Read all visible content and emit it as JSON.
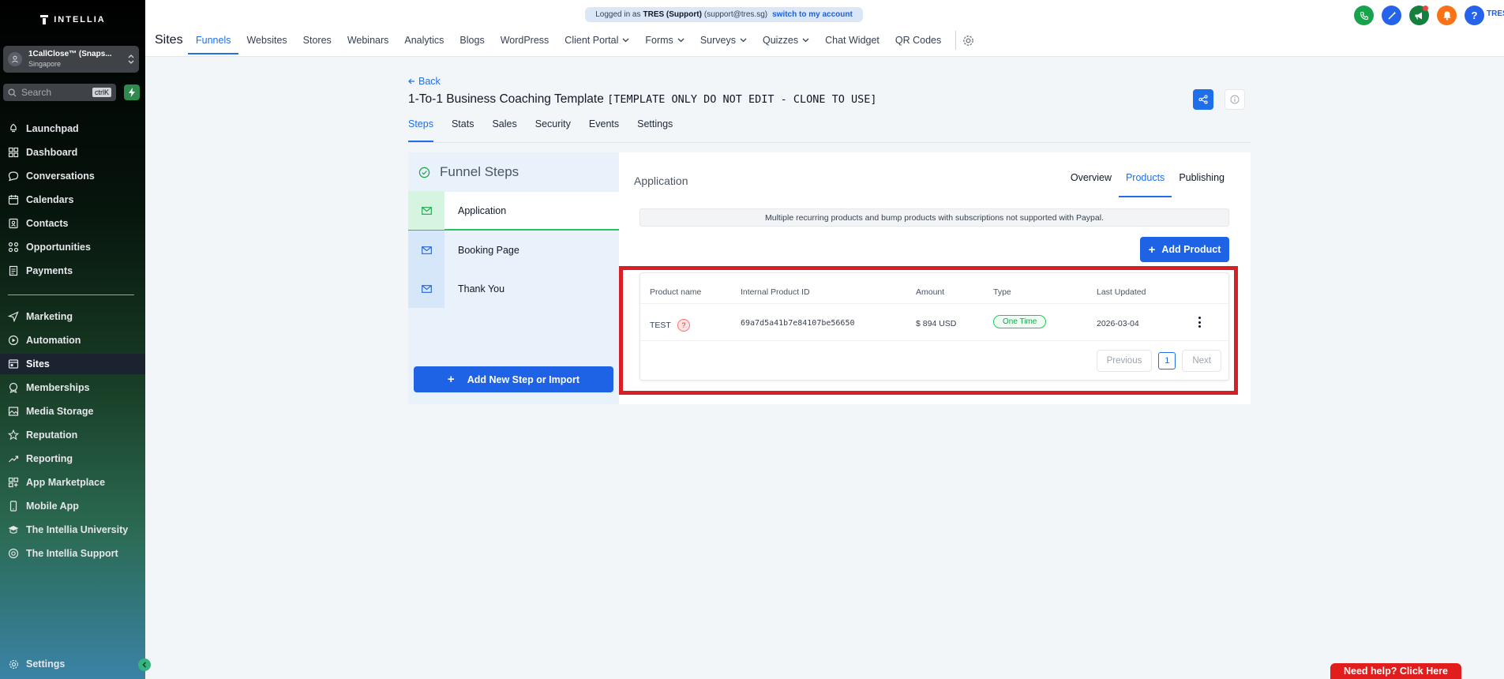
{
  "sidebar": {
    "logo_text": "INTELLIA",
    "account": {
      "name": "1CallClose™ (Snaps...",
      "location": "Singapore"
    },
    "search": {
      "placeholder": "Search",
      "shortcut": "ctrlK"
    },
    "items_top": [
      {
        "label": "Launchpad",
        "icon": "rocket-icon"
      },
      {
        "label": "Dashboard",
        "icon": "grid-icon"
      },
      {
        "label": "Conversations",
        "icon": "chat-icon"
      },
      {
        "label": "Calendars",
        "icon": "calendar-icon"
      },
      {
        "label": "Contacts",
        "icon": "contacts-icon"
      },
      {
        "label": "Opportunities",
        "icon": "opportunities-icon"
      },
      {
        "label": "Payments",
        "icon": "payments-icon"
      }
    ],
    "items_bottom": [
      {
        "label": "Marketing",
        "icon": "send-icon"
      },
      {
        "label": "Automation",
        "icon": "automation-icon"
      },
      {
        "label": "Sites",
        "icon": "sites-icon",
        "active": true
      },
      {
        "label": "Memberships",
        "icon": "membership-icon"
      },
      {
        "label": "Media Storage",
        "icon": "image-icon"
      },
      {
        "label": "Reputation",
        "icon": "star-icon"
      },
      {
        "label": "Reporting",
        "icon": "trend-icon"
      },
      {
        "label": "App Marketplace",
        "icon": "apps-icon"
      },
      {
        "label": "Mobile App",
        "icon": "mobile-icon"
      },
      {
        "label": "The Intellia University",
        "icon": "graduation-icon"
      },
      {
        "label": "The Intellia Support",
        "icon": "support-icon"
      }
    ],
    "settings_label": "Settings"
  },
  "topbar": {
    "login_prefix": "Logged in as",
    "login_user": "TRES (Support)",
    "login_email": "(support@tres.sg)",
    "switch_link": "switch to my account",
    "section_title": "Sites",
    "nav": [
      {
        "label": "Funnels",
        "active": true
      },
      {
        "label": "Websites"
      },
      {
        "label": "Stores"
      },
      {
        "label": "Webinars"
      },
      {
        "label": "Analytics"
      },
      {
        "label": "Blogs"
      },
      {
        "label": "WordPress"
      },
      {
        "label": "Client Portal",
        "dropdown": true
      },
      {
        "label": "Forms",
        "dropdown": true
      },
      {
        "label": "Surveys",
        "dropdown": true
      },
      {
        "label": "Quizzes",
        "dropdown": true
      },
      {
        "label": "Chat Widget"
      },
      {
        "label": "QR Codes"
      }
    ],
    "user_initials": "TRES",
    "colors": {
      "phone": "#16a34a",
      "magic": "#2563eb",
      "announce": "#15803d",
      "bell": "#f97316",
      "help": "#2563eb"
    }
  },
  "page": {
    "back_label": "Back",
    "title": "1-To-1 Business Coaching Template",
    "title_suffix": "[TEMPLATE ONLY DO NOT EDIT - CLONE TO USE]",
    "tabs": [
      "Steps",
      "Stats",
      "Sales",
      "Security",
      "Events",
      "Settings"
    ],
    "active_tab": "Steps"
  },
  "funnel_steps": {
    "header": "Funnel Steps",
    "steps": [
      {
        "label": "Application",
        "active": true
      },
      {
        "label": "Booking Page"
      },
      {
        "label": "Thank You"
      }
    ],
    "add_button": "Add New Step or Import"
  },
  "product_panel": {
    "section_title": "Application",
    "subtabs": [
      "Overview",
      "Products",
      "Publishing"
    ],
    "active_subtab": "Products",
    "notice": "Multiple recurring products and bump products with subscriptions not supported with Paypal.",
    "add_button": "Add Product",
    "table": {
      "headers": [
        "Product name",
        "Internal Product ID",
        "Amount",
        "Type",
        "Last Updated"
      ],
      "rows": [
        {
          "name": "TEST",
          "id": "69a7d5a41b7e84107be56650",
          "amount": "$ 894 USD",
          "type": "One Time",
          "updated": "2026-03-04"
        }
      ]
    },
    "pagination": {
      "previous": "Previous",
      "page": "1",
      "next": "Next"
    }
  },
  "help_button": "Need help? Click Here"
}
